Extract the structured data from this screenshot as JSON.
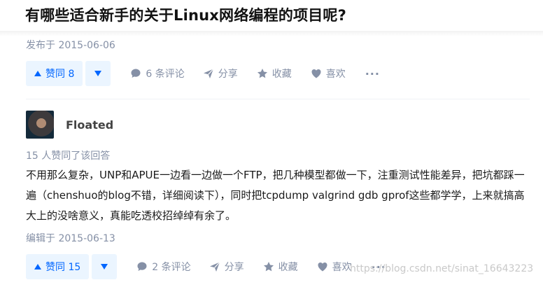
{
  "question": {
    "title": "有哪些适合新手的关于Linux网络编程的项目呢?"
  },
  "post1": {
    "date": "发布于 2015-06-06",
    "vote_label": "赞同 8",
    "comments": "6 条评论",
    "share": "分享",
    "favorite": "收藏",
    "like": "喜欢",
    "more": "···"
  },
  "answer": {
    "author": "Floated",
    "votes_text": "15 人赞同了该回答",
    "content": "不用那么复杂，UNP和APUE一边看一边做一个FTP，把几种模型都做一下，注重测试性能差异，把坑都踩一遍（chenshuo的blog不错，详细阅读下），同时把tcpdump valgrind gdb gprof这些都学学，上来就搞高大上的没啥意义，真能吃透校招绰绰有余了。",
    "edited": "编辑于 2015-06-13",
    "vote_label": "赞同 15",
    "comments": "2 条评论",
    "share": "分享",
    "favorite": "收藏",
    "like": "喜欢",
    "more": "···"
  },
  "watermark": "https://blog.csdn.net/sinat_16643223",
  "colors": {
    "accent": "#0066ff",
    "accent_bg": "#ebf5ff",
    "muted": "#8590a6"
  }
}
